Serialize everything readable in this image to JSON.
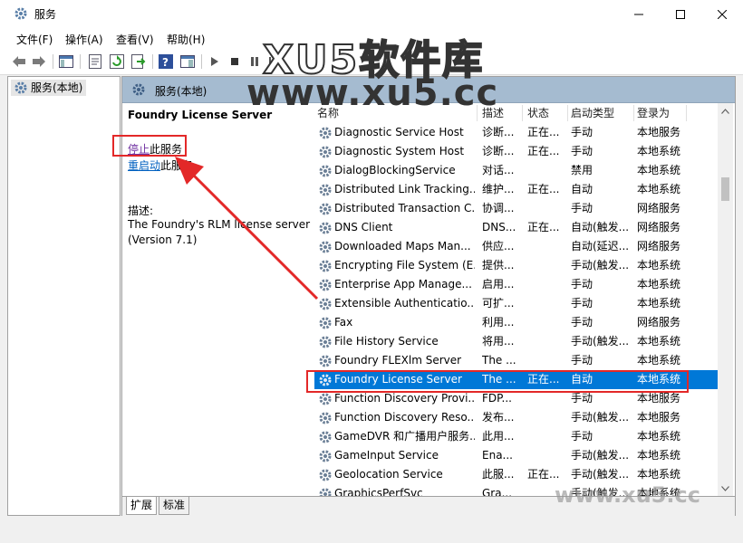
{
  "window": {
    "title": "服务"
  },
  "menu": [
    "文件(F)",
    "操作(A)",
    "查看(V)",
    "帮助(H)"
  ],
  "tree": {
    "root": "服务(本地)"
  },
  "pane": {
    "header": "服务(本地)"
  },
  "detail": {
    "service_name": "Foundry License Server",
    "stop_link": "停止",
    "stop_suffix": "此服务",
    "restart_link": "重启动",
    "restart_suffix": "此服务",
    "desc_label": "描述:",
    "desc_line1": "The Foundry's RLM license server",
    "desc_line2": "(Version 7.1)"
  },
  "columns": [
    "名称",
    "描述",
    "状态",
    "启动类型",
    "登录为"
  ],
  "rows": [
    {
      "name": "Diagnostic Service Host",
      "desc": "诊断...",
      "status": "正在...",
      "startup": "手动",
      "logon": "本地服务"
    },
    {
      "name": "Diagnostic System Host",
      "desc": "诊断...",
      "status": "正在...",
      "startup": "手动",
      "logon": "本地系统"
    },
    {
      "name": "DialogBlockingService",
      "desc": "对话...",
      "status": "",
      "startup": "禁用",
      "logon": "本地系统"
    },
    {
      "name": "Distributed Link Tracking...",
      "desc": "维护...",
      "status": "正在...",
      "startup": "自动",
      "logon": "本地系统"
    },
    {
      "name": "Distributed Transaction C...",
      "desc": "协调...",
      "status": "",
      "startup": "手动",
      "logon": "网络服务"
    },
    {
      "name": "DNS Client",
      "desc": "DNS...",
      "status": "正在...",
      "startup": "自动(触发...",
      "logon": "网络服务"
    },
    {
      "name": "Downloaded Maps Man...",
      "desc": "供应...",
      "status": "",
      "startup": "自动(延迟...",
      "logon": "网络服务"
    },
    {
      "name": "Encrypting File System (E...",
      "desc": "提供...",
      "status": "",
      "startup": "手动(触发...",
      "logon": "本地系统"
    },
    {
      "name": "Enterprise App Manage...",
      "desc": "启用...",
      "status": "",
      "startup": "手动",
      "logon": "本地系统"
    },
    {
      "name": "Extensible Authenticatio...",
      "desc": "可扩...",
      "status": "",
      "startup": "手动",
      "logon": "本地系统"
    },
    {
      "name": "Fax",
      "desc": "利用...",
      "status": "",
      "startup": "手动",
      "logon": "网络服务"
    },
    {
      "name": "File History Service",
      "desc": "将用...",
      "status": "",
      "startup": "手动(触发...",
      "logon": "本地系统"
    },
    {
      "name": "Foundry FLEXlm Server",
      "desc": "The ...",
      "status": "",
      "startup": "手动",
      "logon": "本地系统"
    },
    {
      "name": "Foundry License Server",
      "desc": "The ...",
      "status": "正在...",
      "startup": "自动",
      "logon": "本地系统"
    },
    {
      "name": "Function Discovery Provi...",
      "desc": "FDP...",
      "status": "",
      "startup": "手动",
      "logon": "本地服务"
    },
    {
      "name": "Function Discovery Reso...",
      "desc": "发布...",
      "status": "",
      "startup": "手动(触发...",
      "logon": "本地服务"
    },
    {
      "name": "GameDVR 和广播用户服务...",
      "desc": "此用...",
      "status": "",
      "startup": "手动",
      "logon": "本地系统"
    },
    {
      "name": "GameInput Service",
      "desc": "Ena...",
      "status": "",
      "startup": "手动(触发...",
      "logon": "本地系统"
    },
    {
      "name": "Geolocation Service",
      "desc": "此服...",
      "status": "正在...",
      "startup": "手动(触发...",
      "logon": "本地系统"
    },
    {
      "name": "GraphicsPerfSvc",
      "desc": "Gra...",
      "status": "",
      "startup": "手动(触发...",
      "logon": "本地系统"
    }
  ],
  "selected_index": 13,
  "tabs": [
    "扩展",
    "标准"
  ],
  "watermarks": {
    "top": "XU5软件库",
    "middle": "www.xu5.cc",
    "bottom": "www.xu5.cc"
  },
  "colors": {
    "selection": "#0078d7",
    "highlight_box": "#e32828",
    "pane_header": "#a5bbd0",
    "link": "#0060c0"
  }
}
